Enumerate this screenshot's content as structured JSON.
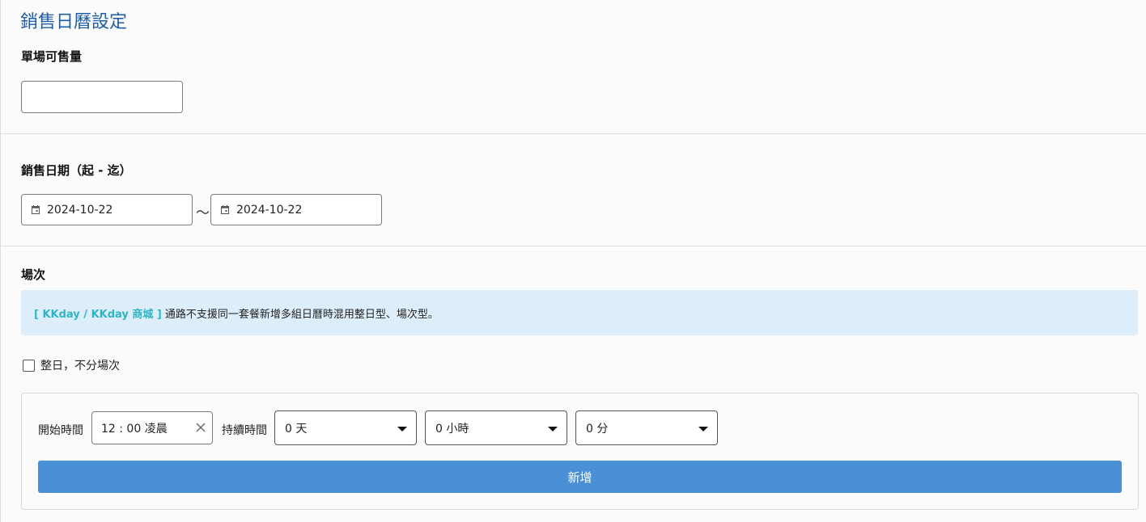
{
  "page": {
    "title": "銷售日曆設定"
  },
  "quantity": {
    "label": "單場可售量",
    "value": ""
  },
  "sale_dates": {
    "label": "銷售日期（起 - 迄）",
    "start": "2024-10-22",
    "separator": "～",
    "end": "2024-10-22",
    "icon": "calendar-icon"
  },
  "session": {
    "label": "場次",
    "notice_tag": "[ KKday / KKday 商城 ]",
    "notice_text": "通路不支援同一套餐新增多組日曆時混用整日型、場次型。",
    "allday_label": "整日，不分場次",
    "allday_checked": false,
    "start_time_label": "開始時間",
    "start_time_value": "12 : 00 凌晨",
    "duration_label": "持續時間",
    "days_value": "0 天",
    "hours_value": "0 小時",
    "minutes_value": "0 分",
    "add_label": "新增"
  },
  "colors": {
    "title": "#1f5ea8",
    "notice_bg": "#ddedf9",
    "notice_tag": "#2fb6c6",
    "button": "#4990d6"
  }
}
